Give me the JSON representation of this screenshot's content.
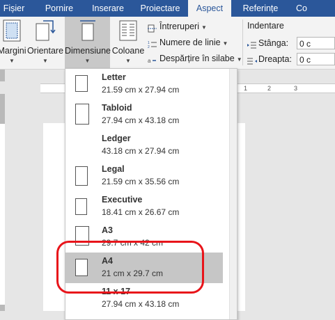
{
  "tabs": [
    {
      "label": "Fișier",
      "active": false
    },
    {
      "label": "Pornire",
      "active": false
    },
    {
      "label": "Inserare",
      "active": false
    },
    {
      "label": "Proiectare",
      "active": false
    },
    {
      "label": "Aspect",
      "active": true
    },
    {
      "label": "Referințe",
      "active": false
    },
    {
      "label": "Co",
      "active": false
    }
  ],
  "ribbon": {
    "margins_label": "Margini",
    "orientation_label": "Orientare",
    "size_label": "Dimensiune",
    "columns_label": "Coloane",
    "breaks_label": "Întreruperi",
    "line_numbers_label": "Numere de linie",
    "hyphenation_label": "Despărțire în silabe",
    "indent_title": "Indentare",
    "indent_left_label": "Stânga:",
    "indent_right_label": "Dreapta:",
    "indent_left_value": "0 c",
    "indent_right_value": "0 c"
  },
  "ruler_numbers": [
    "1",
    "2",
    "3"
  ],
  "accent_color": "#2b579a",
  "highlight_color": "#e8141a",
  "paper_sizes": [
    {
      "name": "Letter",
      "dims": "21.59 cm x 27.94 cm"
    },
    {
      "name": "Tabloid",
      "dims": "27.94 cm x 43.18 cm"
    },
    {
      "name": "Ledger",
      "dims": "43.18 cm x 27.94 cm"
    },
    {
      "name": "Legal",
      "dims": "21.59 cm x 35.56 cm"
    },
    {
      "name": "Executive",
      "dims": "18.41 cm x 26.67 cm"
    },
    {
      "name": "A3",
      "dims": "29.7 cm x 42 cm"
    },
    {
      "name": "A4",
      "dims": "21 cm x 29.7 cm",
      "selected": true
    },
    {
      "name": "11 x 17",
      "dims": "27.94 cm x 43.18 cm"
    }
  ]
}
